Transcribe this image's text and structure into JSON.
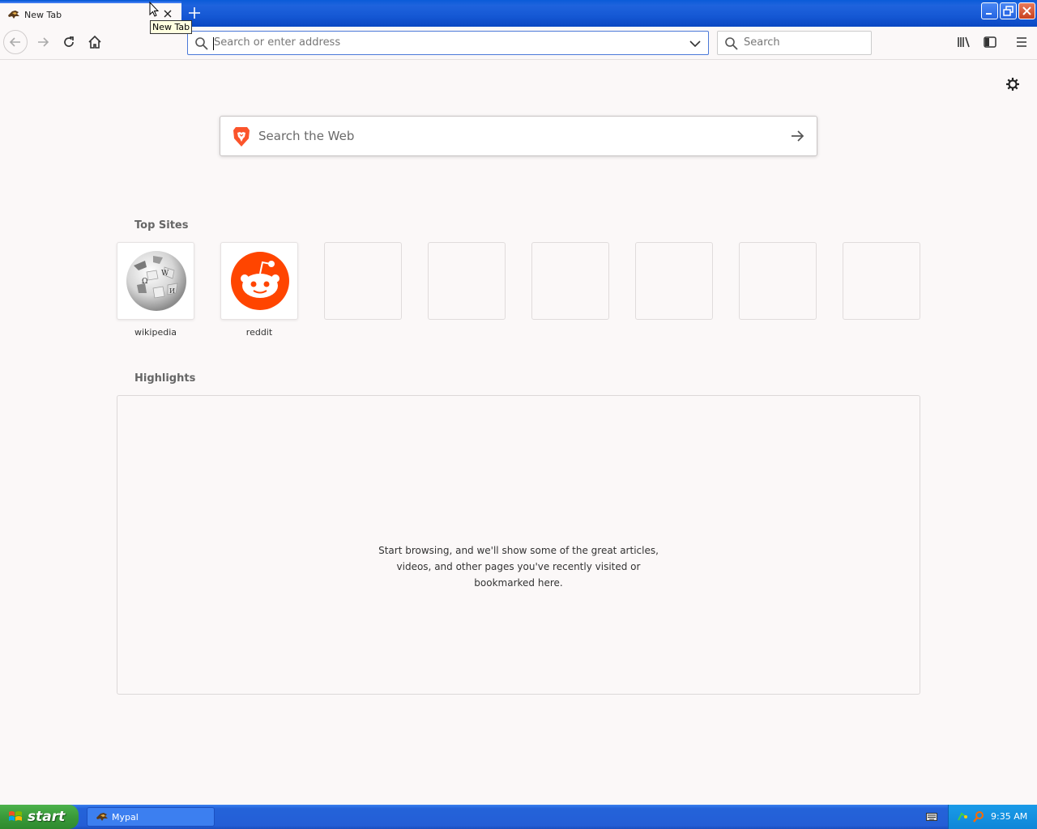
{
  "window": {
    "tab_title": "New Tab",
    "tooltip": "New Tab"
  },
  "toolbar": {
    "url_placeholder": "Search or enter address",
    "search_placeholder": "Search"
  },
  "newtab": {
    "web_search_placeholder": "Search the Web",
    "top_sites_title": "Top Sites",
    "top_sites": [
      {
        "label": "wikipedia"
      },
      {
        "label": "reddit"
      },
      {
        "label": ""
      },
      {
        "label": ""
      },
      {
        "label": ""
      },
      {
        "label": ""
      },
      {
        "label": ""
      },
      {
        "label": ""
      }
    ],
    "highlights_title": "Highlights",
    "highlights_empty_line1": "Start browsing, and we'll show some of the great articles,",
    "highlights_empty_line2": "videos, and other pages you've recently visited or",
    "highlights_empty_line3": "bookmarked here."
  },
  "taskbar": {
    "start_label": "start",
    "task_label": "Mypal",
    "clock": "9:35 AM"
  },
  "colors": {
    "accent": "#4a79d8",
    "reddit": "#ff4500",
    "brave": "#fb542b",
    "xp_blue": "#245ed6",
    "xp_green": "#3a9a3a"
  }
}
